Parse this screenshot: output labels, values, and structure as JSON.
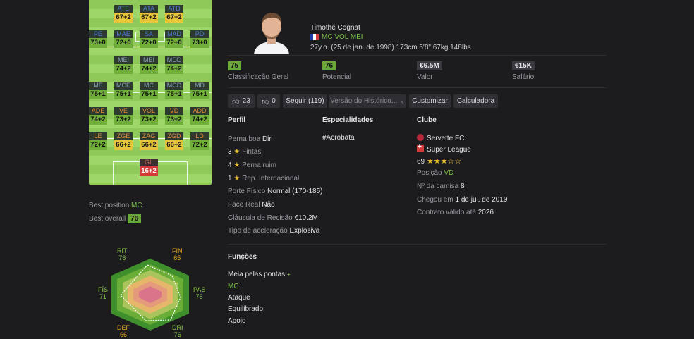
{
  "pitch": {
    "rows": [
      [
        {
          "n": "ATE",
          "v": "67+2",
          "c": "y"
        },
        {
          "n": "ATA",
          "v": "67+2",
          "c": "y"
        },
        {
          "n": "ATD",
          "v": "67+2",
          "c": "y"
        }
      ],
      [
        {
          "n": "PE",
          "v": "73+0",
          "c": "g"
        },
        {
          "n": "MAE",
          "v": "72+0",
          "c": "g"
        },
        {
          "n": "SA",
          "v": "72+0",
          "c": "g"
        },
        {
          "n": "MAD",
          "v": "72+0",
          "c": "g"
        },
        {
          "n": "PD",
          "v": "73+0",
          "c": "g"
        }
      ],
      [
        {
          "n": "MEI",
          "v": "74+2",
          "c": "g"
        },
        {
          "n": "MEI",
          "v": "74+2",
          "c": "g"
        },
        {
          "n": "MDD",
          "v": "74+2",
          "c": "g"
        }
      ],
      [
        {
          "n": "ME",
          "v": "75+1",
          "c": "g"
        },
        {
          "n": "MCE",
          "v": "75+1",
          "c": "g"
        },
        {
          "n": "MC",
          "v": "75+1",
          "c": "g"
        },
        {
          "n": "MCD",
          "v": "75+1",
          "c": "g"
        },
        {
          "n": "MD",
          "v": "75+1",
          "c": "g"
        }
      ],
      [
        {
          "n": "ADE",
          "v": "74+2",
          "c": "g"
        },
        {
          "n": "VE",
          "v": "73+2",
          "c": "g"
        },
        {
          "n": "VOL",
          "v": "73+2",
          "c": "g"
        },
        {
          "n": "VD",
          "v": "73+2",
          "c": "g"
        },
        {
          "n": "ADD",
          "v": "74+2",
          "c": "g"
        }
      ],
      [
        {
          "n": "LE",
          "v": "72+2",
          "c": "g"
        },
        {
          "n": "ZGE",
          "v": "66+2",
          "c": "y"
        },
        {
          "n": "ZAG",
          "v": "66+2",
          "c": "y"
        },
        {
          "n": "ZGD",
          "v": "66+2",
          "c": "y"
        },
        {
          "n": "LD",
          "v": "72+2",
          "c": "g"
        }
      ],
      [
        {
          "n": "GL",
          "v": "16+2",
          "c": "r"
        }
      ]
    ]
  },
  "best": {
    "position_label": "Best position",
    "position": "MC",
    "overall_label": "Best overall",
    "overall": "76"
  },
  "radar": {
    "stats": [
      {
        "name": "RIT",
        "value": "78"
      },
      {
        "name": "FIN",
        "value": "65"
      },
      {
        "name": "PAS",
        "value": "75"
      },
      {
        "name": "DRI",
        "value": "76"
      },
      {
        "name": "DEF",
        "value": "66"
      },
      {
        "name": "FÍS",
        "value": "71"
      }
    ]
  },
  "player": {
    "name": "Timothé Cognat",
    "positions": "MC VOL MEI",
    "info": "27y.o. (25 de jan. de 1998) 173cm 5'8\" 67kg 148lbs"
  },
  "stats": [
    {
      "value": "75",
      "label": "Classificação Geral",
      "style": "green"
    },
    {
      "value": "76",
      "label": "Potencial",
      "style": "green"
    },
    {
      "value": "€6.5M",
      "label": "Valor",
      "style": "gray"
    },
    {
      "value": "€15K",
      "label": "Salário",
      "style": "gray"
    }
  ],
  "actions": {
    "likes": "23",
    "dislikes": "0",
    "follow": "Seguir (119)",
    "history": "Versão do Histórico...",
    "customize": "Customizar",
    "calculator": "Calculadora"
  },
  "profile": {
    "title": "Perfil",
    "foot_label": "Perna boa",
    "foot": "Dir.",
    "skills_num": "3",
    "skills_label": "Fintas",
    "weak_num": "4",
    "weak_label": "Perna ruim",
    "rep_num": "1",
    "rep_label": "Rep. Internacional",
    "body_label": "Porte Físico",
    "body": "Normal (170-185)",
    "face_label": "Face Real",
    "face": "Não",
    "release_label": "Cláusula de Recisão",
    "release": "€10.2M",
    "accel_label": "Tipo de aceleração",
    "accel": "Explosiva"
  },
  "specialties": {
    "title": "Especialidades",
    "items": [
      "#Acrobata"
    ]
  },
  "club": {
    "title": "Clube",
    "name": "Servette FC",
    "league": "Super League",
    "rating": "69",
    "position_label": "Posição",
    "position": "VD",
    "jersey_label": "Nº da camisa",
    "jersey": "8",
    "joined_label": "Chegou em",
    "joined": "1 de jul. de 2019",
    "contract_label": "Contrato válido até",
    "contract": "2026"
  },
  "roles": {
    "title": "Funções",
    "role": "Meia pelas pontas",
    "role_pos": "MC",
    "items": [
      "Ataque",
      "Equilibrado",
      "Apoio"
    ]
  }
}
